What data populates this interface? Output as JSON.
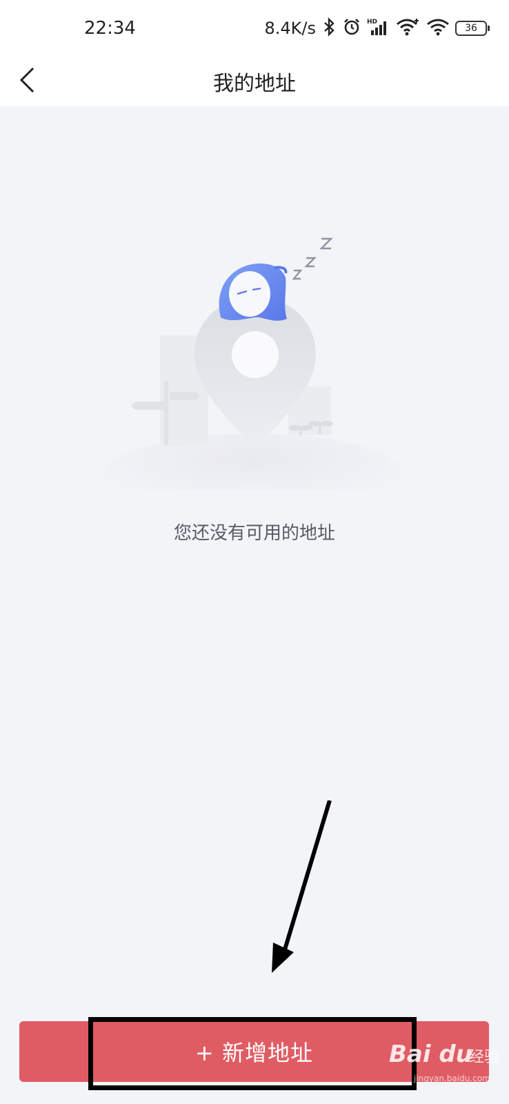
{
  "status_bar": {
    "time": "22:34",
    "network_speed": "8.4K/s",
    "battery": "36",
    "icons": [
      "bluetooth-icon",
      "alarm-icon",
      "signal-hd-icon",
      "wifi-plus-icon",
      "wifi-icon",
      "battery-icon"
    ]
  },
  "header": {
    "title": "我的地址",
    "back_icon": "chevron-left-icon"
  },
  "empty_state": {
    "illustration": "sleeping-location-pin-illustration",
    "message": "您还没有可用的地址"
  },
  "action": {
    "add_label": "+ 新增地址"
  },
  "watermark": {
    "brand": "Bai du",
    "sub": "经验",
    "url": "jingyan.baidu.com"
  },
  "colors": {
    "background": "#f3f4f8",
    "button": "#e05c64",
    "mascot": "#6c8cf0"
  }
}
